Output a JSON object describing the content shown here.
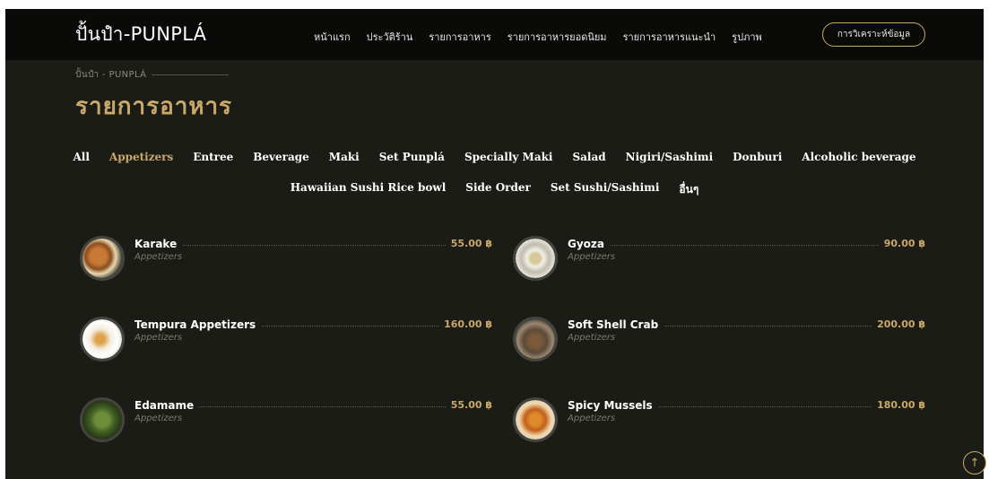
{
  "header": {
    "brand": "ปั้นปำ-PUNPLÁ",
    "nav": [
      "หน้าแรก",
      "ประวัติร้าน",
      "รายการอาหาร",
      "รายการอาหารยอดนิยม",
      "รายการอาหารแนะนำ",
      "รูปภาพ"
    ],
    "cta_label": "การวิเคราะห์ข้อมูล"
  },
  "breadcrumb": "ปั้นปำ - PUNPLÁ",
  "page_title": "รายการอาหาร",
  "categories_row1": [
    "All",
    "Appetizers",
    "Entree",
    "Beverage",
    "Maki",
    "Set Punplá",
    "Specially Maki",
    "Salad",
    "Nigiri/Sashimi",
    "Donburi",
    "Alcoholic beverage"
  ],
  "categories_row2": [
    "Hawaiian Sushi Rice bowl",
    "Side Order",
    "Set Sushi/Sashimi",
    "อื่นๆ"
  ],
  "active_category": "Appetizers",
  "items": [
    {
      "name": "Karake",
      "category": "Appetizers",
      "price": "55.00 ฿",
      "icon": "fried-chicken-icon"
    },
    {
      "name": "Gyoza",
      "category": "Appetizers",
      "price": "90.00 ฿",
      "icon": "dumpling-icon"
    },
    {
      "name": "Tempura Appetizers",
      "category": "Appetizers",
      "price": "160.00 ฿",
      "icon": "tempura-icon"
    },
    {
      "name": "Soft Shell Crab",
      "category": "Appetizers",
      "price": "200.00 ฿",
      "icon": "crab-icon"
    },
    {
      "name": "Edamame",
      "category": "Appetizers",
      "price": "55.00 ฿",
      "icon": "edamame-icon"
    },
    {
      "name": "Spicy Mussels",
      "category": "Appetizers",
      "price": "180.00 ฿",
      "icon": "mussel-icon"
    }
  ],
  "colors": {
    "accent": "#c9a86a",
    "background": "#1c1c17",
    "header": "#0a0a08"
  },
  "scroll_top_icon": "arrow-up-icon"
}
